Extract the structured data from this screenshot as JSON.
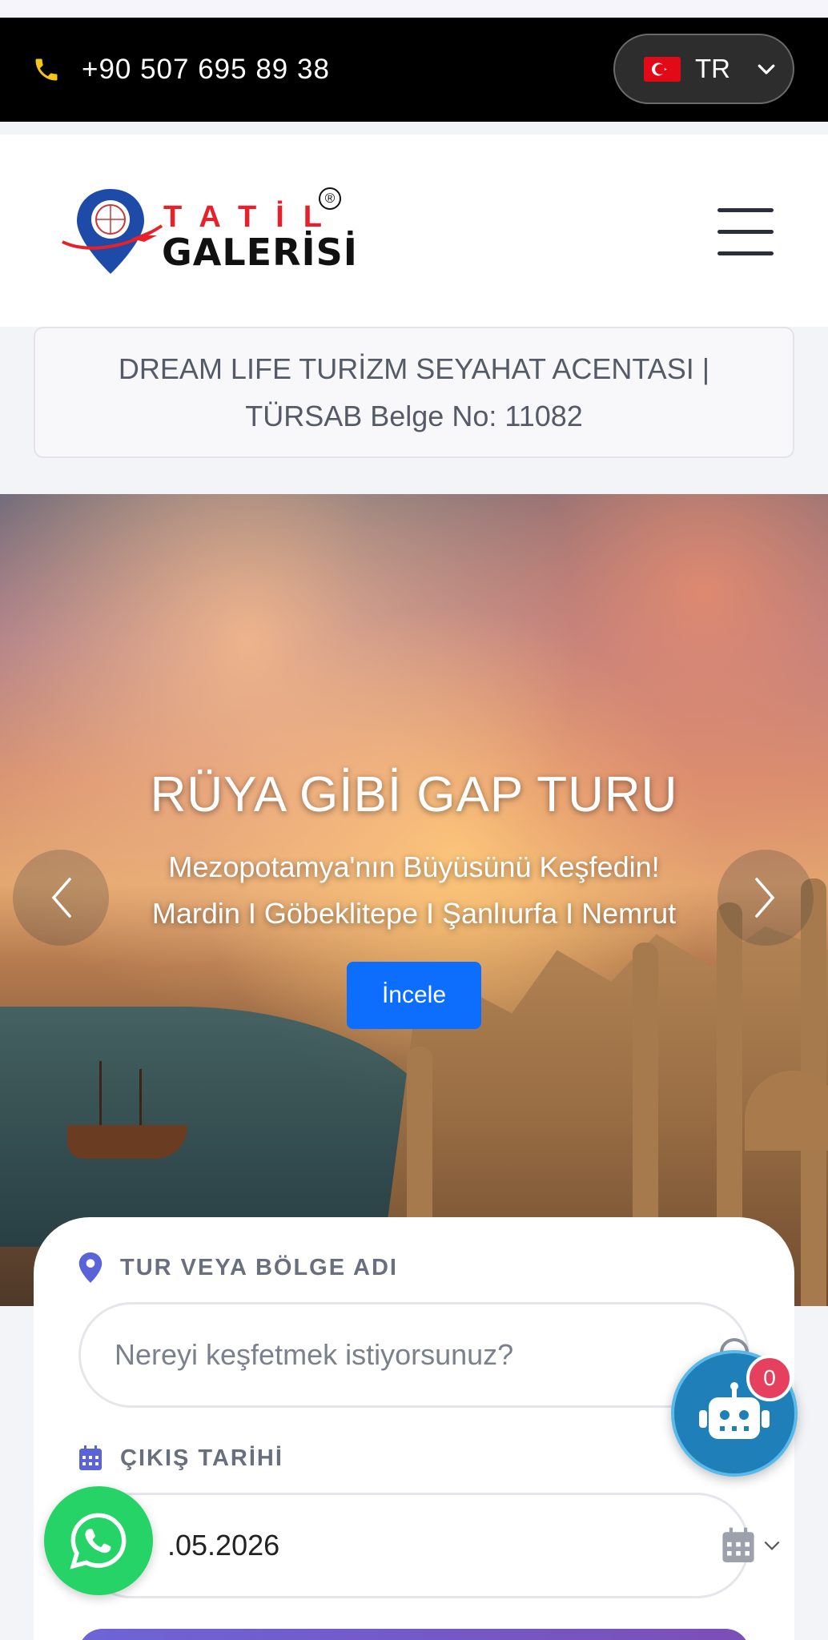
{
  "topbar": {
    "phone": "+90 507 695 89 38",
    "phone_icon": "phone-icon",
    "language": "TR",
    "language_flag": "turkey-flag-icon"
  },
  "header": {
    "logo_word1": "TATİL",
    "logo_word2": "GALERİSİ",
    "logo_mark": "®",
    "menu_icon": "hamburger-menu-icon"
  },
  "license_notice": "DREAM LIFE TURİZM SEYAHAT ACENTASI | TÜRSAB Belge No: 11082",
  "hero": {
    "title": "RÜYA GİBİ GAP TURU",
    "subtitle_line1": "Mezopotamya'nın Büyüsünü Keşfedin!",
    "subtitle_line2": "Mardin I Göbeklitepe I Şanlıurfa I Nemrut",
    "cta": "İncele",
    "colors": {
      "button": "#0d6efd"
    }
  },
  "search": {
    "destination_label": "TUR VEYA BÖLGE ADI",
    "destination_placeholder": "Nereyi keşfetmek istiyorsunuz?",
    "date_label": "ÇIKIŞ TARİHİ",
    "date_value": ".05.2026"
  },
  "chatbot": {
    "badge_count": "0"
  },
  "colors": {
    "topbar_bg": "#000000",
    "accent_red": "#e8202a",
    "whatsapp": "#25d366",
    "chatbot": "#1f7fb8"
  }
}
